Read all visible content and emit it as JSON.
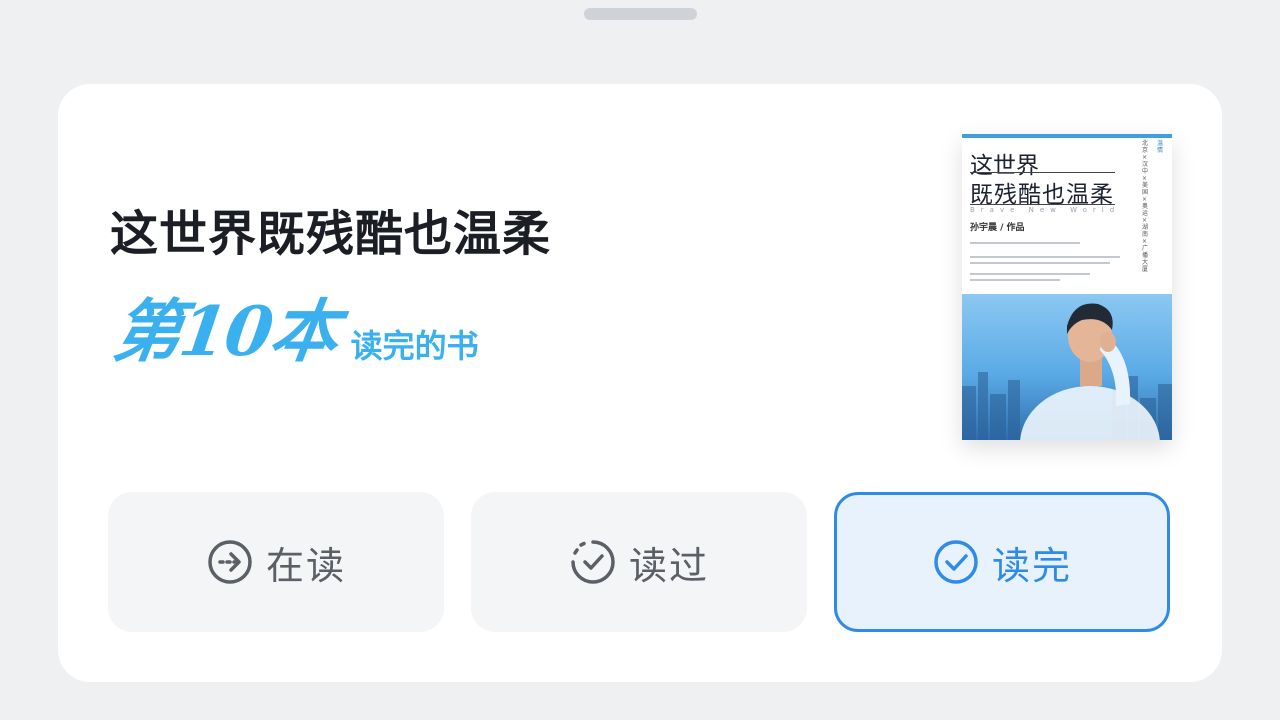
{
  "book": {
    "title": "这世界既残酷也温柔",
    "milestone_count": "第10本",
    "milestone_text": "读完的书"
  },
  "cover": {
    "title_line1": "这世界",
    "title_line2": "既残酷也温柔",
    "subtitle": "Brave New World",
    "author": "孙宇晨 / 作品",
    "side_text": "北京×汉中×美国×奥运×湖南×广播大厦",
    "side_text_2": "温情"
  },
  "actions": [
    {
      "label": "在读",
      "icon": "arrow-right-circle-icon"
    },
    {
      "label": "读过",
      "icon": "dashed-check-circle-icon"
    },
    {
      "label": "读完",
      "icon": "check-circle-icon",
      "selected": true
    }
  ],
  "colors": {
    "accent": "#2f8be6",
    "milestone": "#3ab1ee",
    "button_bg": "#f4f5f6",
    "selected_bg": "#e8f2fd"
  }
}
